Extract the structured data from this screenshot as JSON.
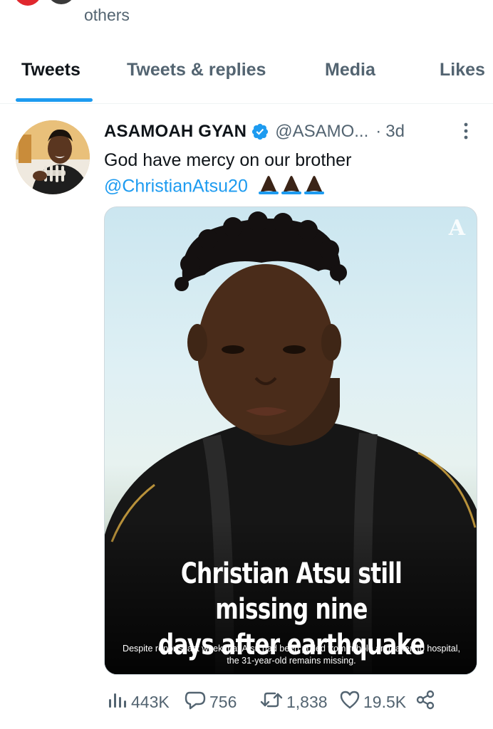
{
  "profile_header": {
    "followers_text": "others"
  },
  "tabs": [
    {
      "label": "Tweets",
      "active": true
    },
    {
      "label": "Tweets & replies",
      "active": false
    },
    {
      "label": "Media",
      "active": false
    },
    {
      "label": "Likes",
      "active": false
    }
  ],
  "tweet": {
    "author_name": "ASAMOAH GYAN",
    "verified": true,
    "handle": "@ASAMO...",
    "separator": "·",
    "time": "3d",
    "text_line1": "God have mercy on our brother",
    "mention": "@ChristianAtsu20",
    "emoji": "🙏🏿🙏🏿🙏🏿",
    "media": {
      "watermark": "A",
      "headline_line1": "Christian Atsu still missing nine",
      "headline_line2": "days after earthquake",
      "subline_line1": "Despite reports last week that Atsu had been pulled from rubble and taken to hospital,",
      "subline_line2": "the 31-year-old remains missing."
    },
    "stats": {
      "views": "443K",
      "replies": "756",
      "retweets": "1,838",
      "likes": "19.5K"
    }
  },
  "colors": {
    "accent": "#1d9bf0",
    "muted": "#536471",
    "text": "#0f1419"
  }
}
